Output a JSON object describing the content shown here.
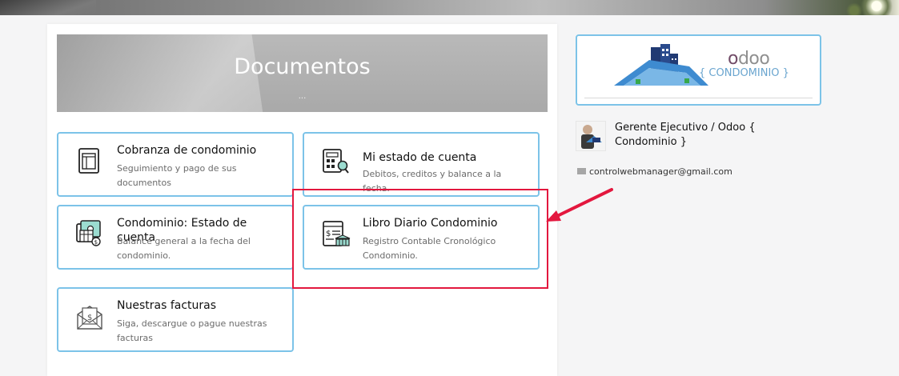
{
  "page": {
    "heading": "Documentos",
    "heading_sub": "..."
  },
  "tiles": [
    {
      "title": "Cobranza de condominio",
      "desc": "Seguimiento y pago de sus documentos",
      "icon": "document-ledger-icon"
    },
    {
      "title": "Mi estado de cuenta",
      "desc": "Debitos, creditos y balance a la fecha.",
      "icon": "calculator-search-icon"
    },
    {
      "title": "Condominio: Estado de cuenta",
      "desc": "Balance general a la fecha del condominio.",
      "icon": "statement-money-icon"
    },
    {
      "title": "Libro Diario Condominio",
      "desc": "Registro Contable Cronológico Condominio.",
      "icon": "ledger-bank-icon"
    },
    {
      "title": "Nuestras facturas",
      "desc": "Siga, descargue o pague nuestras facturas",
      "icon": "envelope-invoice-icon"
    }
  ],
  "sidebar": {
    "logo_brand": "odoo",
    "logo_sub": "{ CONDOMINIO }",
    "person_name": "Gerente Ejecutivo / Odoo { Condominio }",
    "email": "controlwebmanager@gmail.com"
  },
  "colors": {
    "tile_border": "#7cc3e8",
    "highlight": "#e3173e",
    "odoo_purple": "#714b67"
  }
}
